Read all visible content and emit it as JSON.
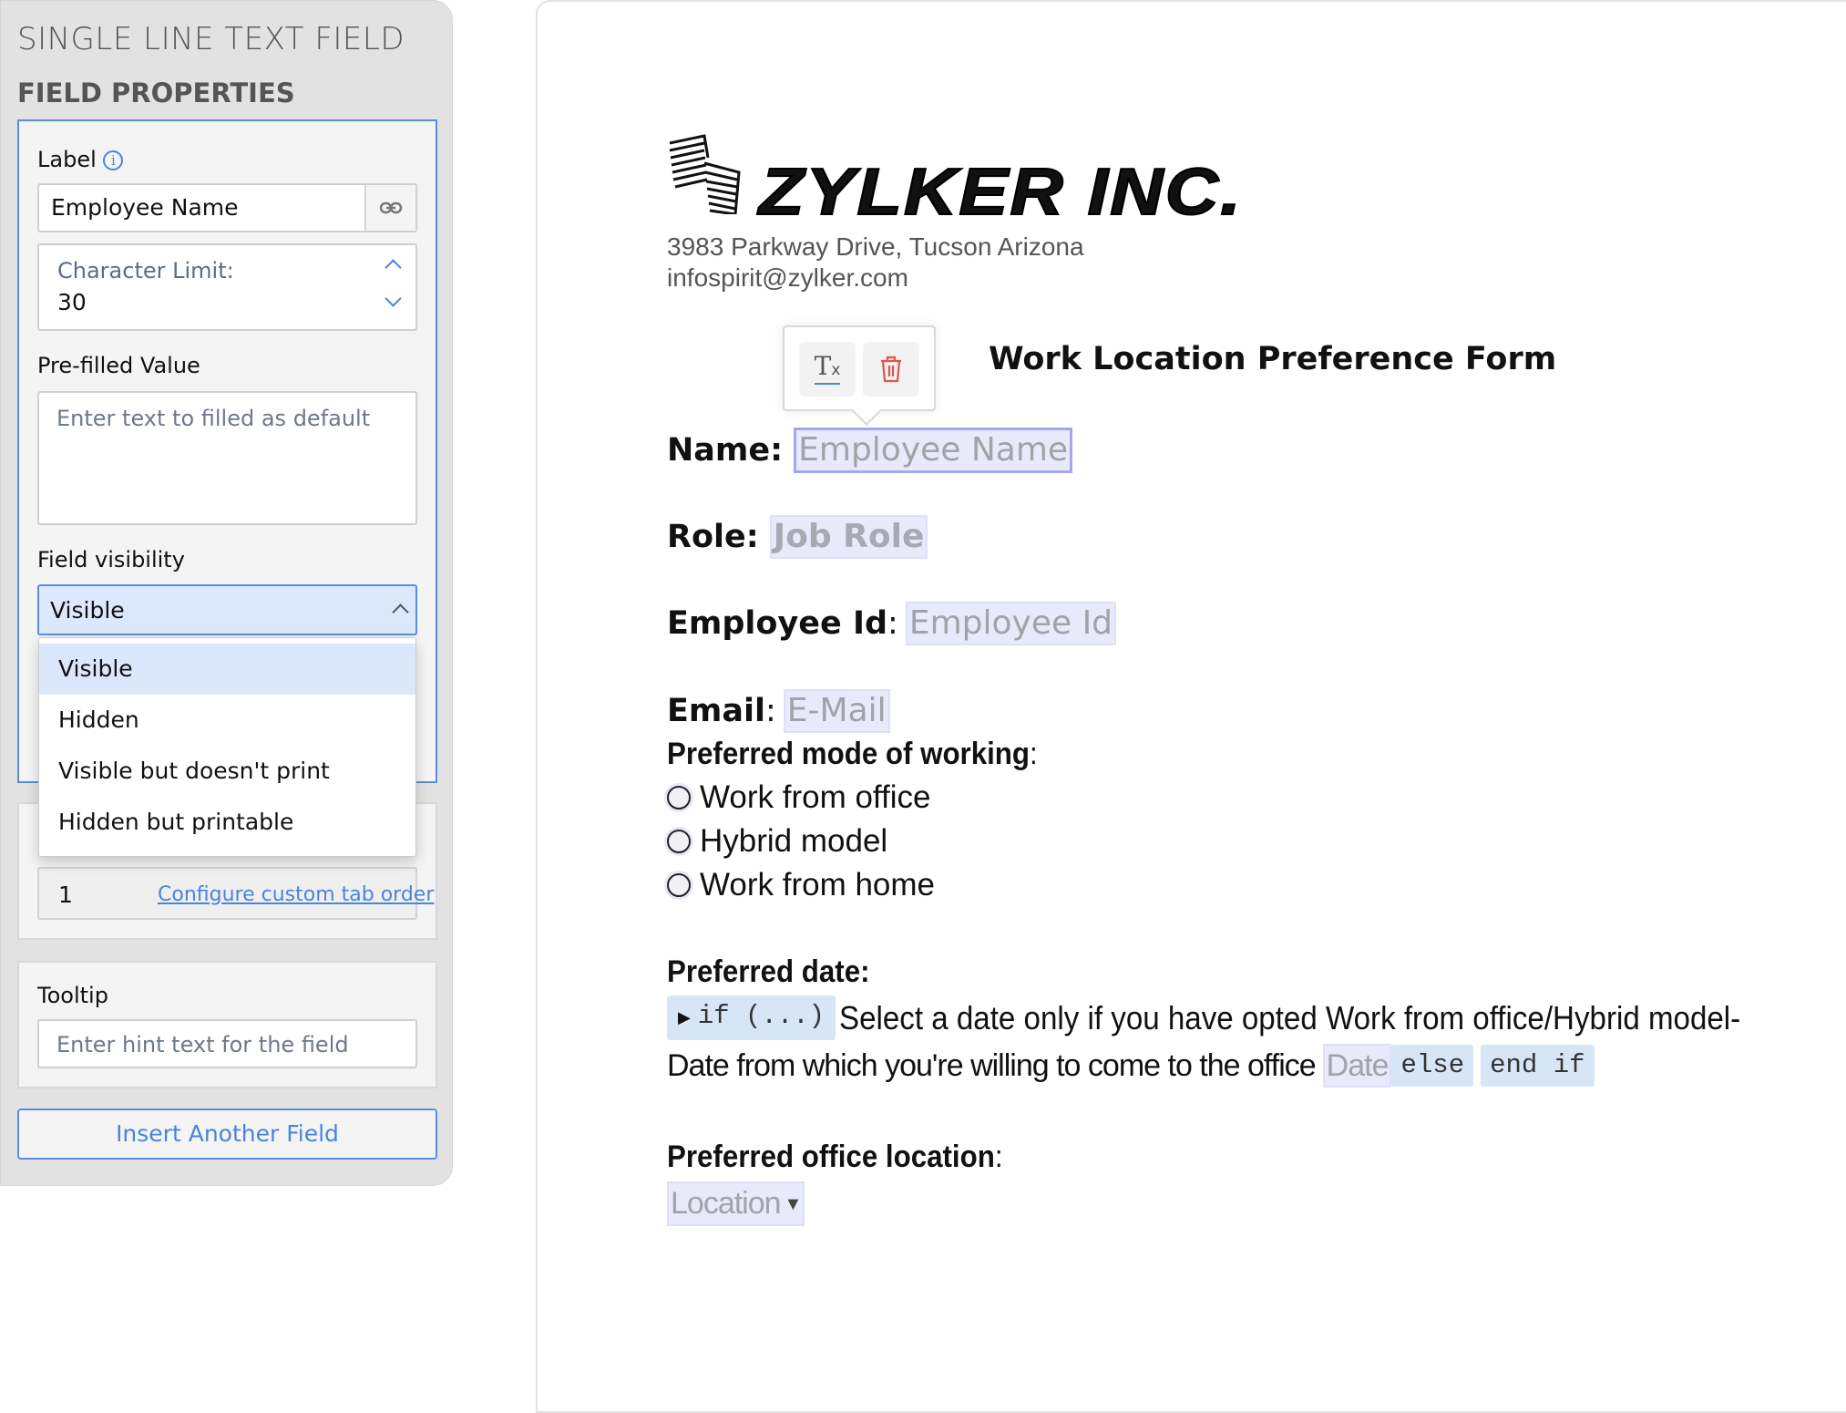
{
  "panel": {
    "title": "SINGLE LINE TEXT FIELD",
    "section": "FIELD PROPERTIES",
    "label": {
      "title": "Label",
      "value": "Employee Name"
    },
    "char_limit": {
      "title": "Character Limit:",
      "value": "30"
    },
    "prefilled": {
      "title": "Pre-filled Value",
      "placeholder": "Enter text to filled as default"
    },
    "visibility": {
      "title": "Field visibility",
      "selected": "Visible",
      "options": [
        "Visible",
        "Hidden",
        "Visible but doesn't print",
        "Hidden but printable"
      ]
    },
    "tab_order": {
      "value": "1",
      "link": "Configure custom tab order"
    },
    "tooltip": {
      "title": "Tooltip",
      "placeholder": "Enter hint text for the field"
    },
    "insert_button": "Insert Another Field",
    "accent": "#5a8ee2"
  },
  "doc": {
    "company": "ZYLKER INC.",
    "address": "3983 Parkway Drive, Tucson Arizona",
    "email": "infospirit@zylker.com",
    "form_title": "Work Location Preference Form",
    "fields": {
      "name": {
        "label": "Name:",
        "value": "Employee Name"
      },
      "role": {
        "label": "Role:",
        "value": "Job Role"
      },
      "employee_id": {
        "label": "Employee Id",
        "value": "Employee Id"
      },
      "email": {
        "label": "Email",
        "value": "E-Mail"
      }
    },
    "mode": {
      "label": "Preferred mode of working",
      "options": [
        "Work from office",
        "Hybrid model",
        "Work from home"
      ]
    },
    "date": {
      "label": "Preferred date:",
      "if_tag": "if (...)",
      "text1": "Select a date only if you have opted Work from office/Hybrid model-",
      "text2": "Date from which you're willing to come to the office",
      "field": "Date",
      "else_tag": "else",
      "endif_tag": "end if"
    },
    "location": {
      "label": "Preferred office location",
      "value": "Location"
    }
  }
}
